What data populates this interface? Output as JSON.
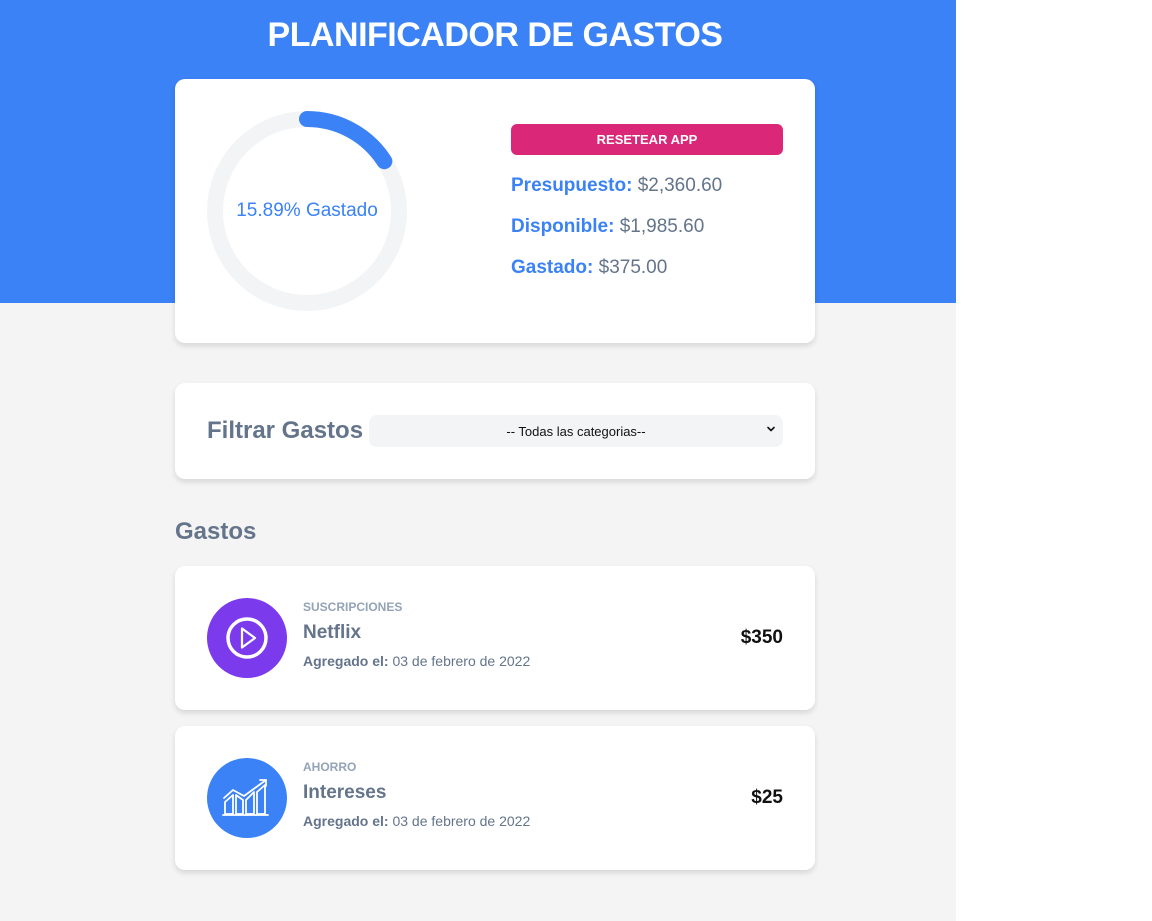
{
  "header": {
    "title": "PLANIFICADOR DE GASTOS",
    "background_color": "#3b82f6"
  },
  "budget": {
    "progress_percent": 15.89,
    "progress_label": "15.89% Gastado",
    "progress_color": "#3b82f6",
    "reset_label": "RESETEAR APP",
    "reset_color": "#db2777",
    "presupuesto_label": "Presupuesto:",
    "presupuesto_value": "$2,360.60",
    "disponible_label": "Disponible:",
    "disponible_value": "$1,985.60",
    "gastado_label": "Gastado:",
    "gastado_value": "$375.00"
  },
  "filter": {
    "label": "Filtrar Gastos",
    "selected": "-- Todas las categorias--"
  },
  "expenses": {
    "heading": "Gastos",
    "items": [
      {
        "category": "SUSCRIPCIONES",
        "name": "Netflix",
        "date_label": "Agregado el:",
        "date": "03 de febrero de 2022",
        "amount": "$350",
        "icon": "play-icon",
        "icon_color": "#7c3aed"
      },
      {
        "category": "AHORRO",
        "name": "Intereses",
        "date_label": "Agregado el:",
        "date": "03 de febrero de 2022",
        "amount": "$25",
        "icon": "savings-chart-icon",
        "icon_color": "#3b82f6"
      }
    ]
  }
}
